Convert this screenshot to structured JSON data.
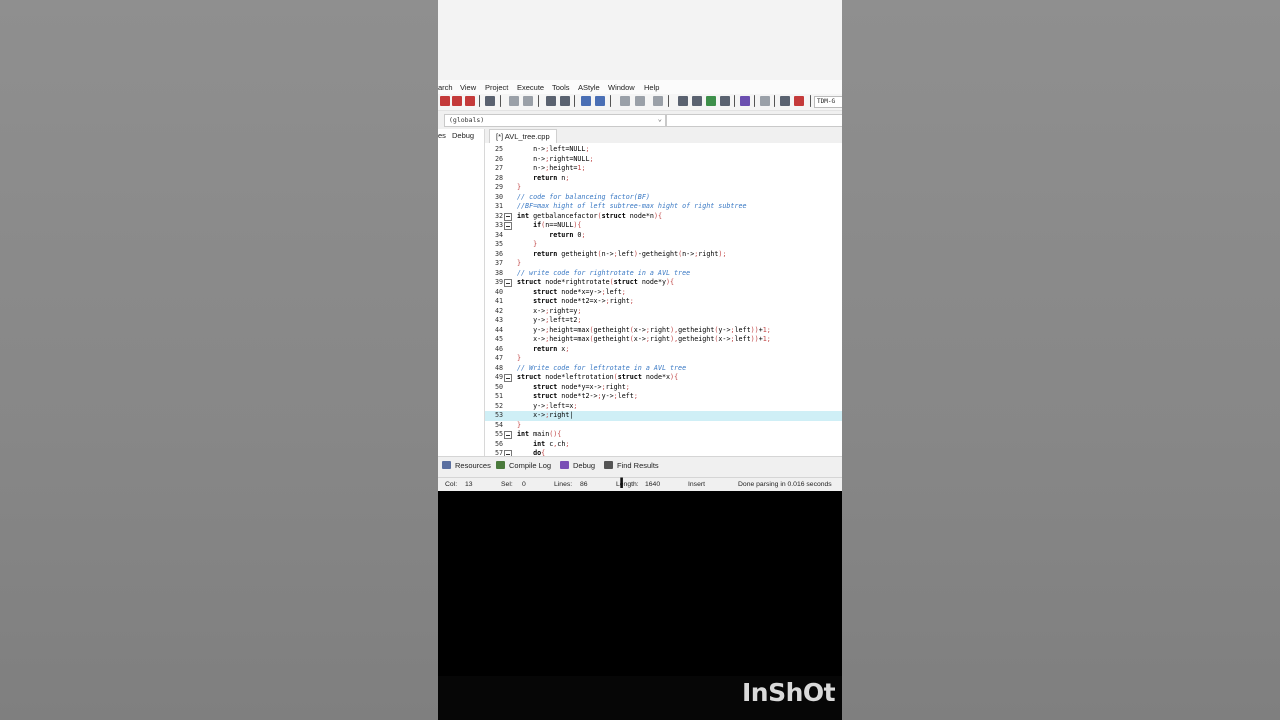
{
  "menubar": [
    "arch",
    "View",
    "Project",
    "Execute",
    "Tools",
    "AStyle",
    "Window",
    "Help"
  ],
  "toolbar": {
    "compiler_label": "TDM-G"
  },
  "scope_selector": {
    "value": "(globals)"
  },
  "left_panel": {
    "tab_partial": "es",
    "tab_debug": "Debug"
  },
  "editor_tab": {
    "label": "[*] AVL_tree.cpp"
  },
  "code_lines": [
    {
      "n": "25",
      "text": "    n->left=NULL;"
    },
    {
      "n": "26",
      "text": "    n->right=NULL;"
    },
    {
      "n": "27",
      "text": "    n->height=1;"
    },
    {
      "n": "28",
      "text": "    return n;"
    },
    {
      "n": "29",
      "text": "}"
    },
    {
      "n": "30",
      "text": "// code for balanceing factor(BF)",
      "comment": true
    },
    {
      "n": "31",
      "text": "//BF=max hight of left subtree-max hight of right subtree",
      "comment": true
    },
    {
      "n": "32",
      "text": "int getbalancefactor(struct node*n){",
      "fold": true
    },
    {
      "n": "33",
      "text": "    if(n==NULL){",
      "fold": true
    },
    {
      "n": "34",
      "text": "        return 0;"
    },
    {
      "n": "35",
      "text": "    }"
    },
    {
      "n": "36",
      "text": "    return getheight(n->left)-getheight(n->right);"
    },
    {
      "n": "37",
      "text": "}"
    },
    {
      "n": "38",
      "text": "// write code for rightrotate in a AVL tree",
      "comment": true
    },
    {
      "n": "39",
      "text": "struct node*rightrotate(struct node*y){",
      "fold": true
    },
    {
      "n": "40",
      "text": "    struct node*x=y->left;"
    },
    {
      "n": "41",
      "text": "    struct node*t2=x->right;"
    },
    {
      "n": "42",
      "text": "    x->right=y;"
    },
    {
      "n": "43",
      "text": "    y->left=t2;"
    },
    {
      "n": "44",
      "text": "    y->height=max(getheight(x->right),getheight(y->left))+1;"
    },
    {
      "n": "45",
      "text": "    x->height=max(getheight(x->right),getheight(x->left))+1;"
    },
    {
      "n": "46",
      "text": "    return x;"
    },
    {
      "n": "47",
      "text": "}"
    },
    {
      "n": "48",
      "text": "// Write code for leftrotate in a AVL tree",
      "comment": true
    },
    {
      "n": "49",
      "text": "struct node*leftrotation(struct node*x){",
      "fold": true
    },
    {
      "n": "50",
      "text": "    struct node*y=x->right;"
    },
    {
      "n": "51",
      "text": "    struct node*t2->y->left;"
    },
    {
      "n": "52",
      "text": "    y->left=x;"
    },
    {
      "n": "53",
      "text": "    x->right",
      "highlight": true
    },
    {
      "n": "54",
      "text": "}"
    },
    {
      "n": "55",
      "text": "int main(){",
      "fold": true
    },
    {
      "n": "56",
      "text": "    int c,ch;"
    },
    {
      "n": "57",
      "text": "    do{",
      "fold": true
    }
  ],
  "bottom_tabs": {
    "resources": "Resources",
    "compile_log": "Compile Log",
    "debug": "Debug",
    "find_results": "Find Results"
  },
  "statusbar": {
    "col_label": "Col:",
    "col_value": "13",
    "sel_label": "Sel:",
    "sel_value": "0",
    "lines_label": "Lines:",
    "lines_value": "86",
    "length_label": "Length:",
    "length_value": "1640",
    "mode": "Insert",
    "message": "Done parsing in 0.016 seconds"
  },
  "watermark": "InShOt",
  "colors": {
    "comment": "#3a79c4",
    "highlight_line": "#cfeff6",
    "number": "#c24a4a",
    "background_blur": "#8a8a8a"
  }
}
